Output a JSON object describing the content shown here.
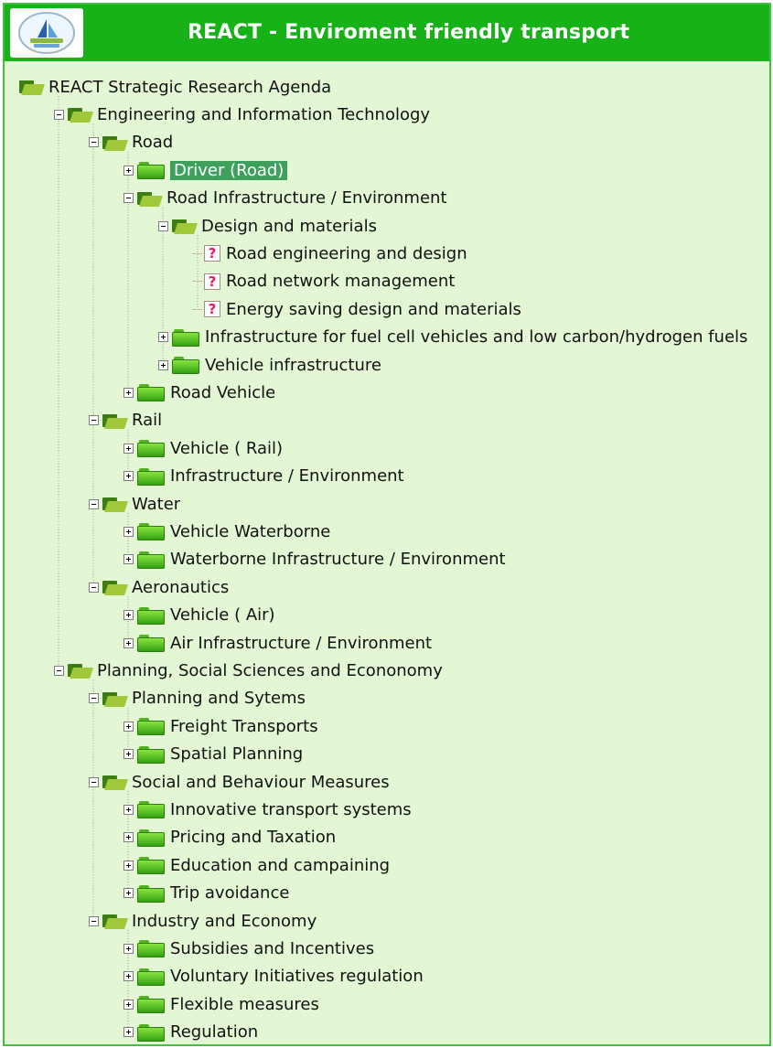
{
  "header": {
    "title": "REACT - Enviroment friendly transport",
    "colors": {
      "header_bg": "#17b217",
      "tree_bg": "#e4f7d4",
      "selection_bg": "#3fa05e"
    },
    "logo": {
      "icon": "react-logo-icon"
    }
  },
  "tree": {
    "icons": {
      "open_folder": "folder-open-icon",
      "closed_folder": "folder-closed-icon",
      "leaf": "question-mark-icon"
    },
    "items": [
      {
        "label": "REACT Strategic Research Agenda",
        "level": 0,
        "icon": "folder-open",
        "toggle": "none"
      },
      {
        "label": "Engineering and Information Technology",
        "level": 1,
        "icon": "folder-open",
        "toggle": "minus"
      },
      {
        "label": "Road",
        "level": 2,
        "icon": "folder-open",
        "toggle": "minus"
      },
      {
        "label": "Driver (Road)",
        "level": 3,
        "icon": "folder-closed",
        "toggle": "plus",
        "selected": true
      },
      {
        "label": "Road Infrastructure / Environment",
        "level": 3,
        "icon": "folder-open",
        "toggle": "minus"
      },
      {
        "label": "Design and materials",
        "level": 4,
        "icon": "folder-open",
        "toggle": "minus"
      },
      {
        "label": "Road engineering and design",
        "level": 5,
        "icon": "question",
        "toggle": "none"
      },
      {
        "label": "Road network management",
        "level": 5,
        "icon": "question",
        "toggle": "none"
      },
      {
        "label": "Energy saving design and materials",
        "level": 5,
        "icon": "question",
        "toggle": "none"
      },
      {
        "label": "Infrastructure for fuel cell vehicles and low carbon/hydrogen fuels",
        "level": 4,
        "icon": "folder-closed",
        "toggle": "plus"
      },
      {
        "label": "Vehicle infrastructure",
        "level": 4,
        "icon": "folder-closed",
        "toggle": "plus"
      },
      {
        "label": "Road Vehicle",
        "level": 3,
        "icon": "folder-closed",
        "toggle": "plus"
      },
      {
        "label": "Rail",
        "level": 2,
        "icon": "folder-open",
        "toggle": "minus"
      },
      {
        "label": "Vehicle ( Rail)",
        "level": 3,
        "icon": "folder-closed",
        "toggle": "plus"
      },
      {
        "label": "Infrastructure / Environment",
        "level": 3,
        "icon": "folder-closed",
        "toggle": "plus"
      },
      {
        "label": "Water",
        "level": 2,
        "icon": "folder-open",
        "toggle": "minus"
      },
      {
        "label": "Vehicle Waterborne",
        "level": 3,
        "icon": "folder-closed",
        "toggle": "plus"
      },
      {
        "label": "Waterborne Infrastructure / Environment",
        "level": 3,
        "icon": "folder-closed",
        "toggle": "plus"
      },
      {
        "label": "Aeronautics",
        "level": 2,
        "icon": "folder-open",
        "toggle": "minus"
      },
      {
        "label": " Vehicle ( Air)",
        "level": 3,
        "icon": "folder-closed",
        "toggle": "plus"
      },
      {
        "label": "Air Infrastructure / Environment",
        "level": 3,
        "icon": "folder-closed",
        "toggle": "plus"
      },
      {
        "label": "Planning, Social Sciences and Econonomy",
        "level": 1,
        "icon": "folder-open",
        "toggle": "minus"
      },
      {
        "label": "Planning and Sytems",
        "level": 2,
        "icon": "folder-open",
        "toggle": "minus"
      },
      {
        "label": "Freight Transports",
        "level": 3,
        "icon": "folder-closed",
        "toggle": "plus"
      },
      {
        "label": "Spatial Planning",
        "level": 3,
        "icon": "folder-closed",
        "toggle": "plus"
      },
      {
        "label": "Social and Behaviour Measures",
        "level": 2,
        "icon": "folder-open",
        "toggle": "minus"
      },
      {
        "label": "Innovative transport systems",
        "level": 3,
        "icon": "folder-closed",
        "toggle": "plus"
      },
      {
        "label": "Pricing and Taxation",
        "level": 3,
        "icon": "folder-closed",
        "toggle": "plus"
      },
      {
        "label": "Education and campaining",
        "level": 3,
        "icon": "folder-closed",
        "toggle": "plus"
      },
      {
        "label": "Trip avoidance",
        "level": 3,
        "icon": "folder-closed",
        "toggle": "plus"
      },
      {
        "label": "Industry and Economy",
        "level": 2,
        "icon": "folder-open",
        "toggle": "minus"
      },
      {
        "label": "Subsidies and Incentives",
        "level": 3,
        "icon": "folder-closed",
        "toggle": "plus"
      },
      {
        "label": "Voluntary Initiatives regulation",
        "level": 3,
        "icon": "folder-closed",
        "toggle": "plus"
      },
      {
        "label": "Flexible measures",
        "level": 3,
        "icon": "folder-closed",
        "toggle": "plus"
      },
      {
        "label": "Regulation",
        "level": 3,
        "icon": "folder-closed",
        "toggle": "plus"
      }
    ]
  }
}
